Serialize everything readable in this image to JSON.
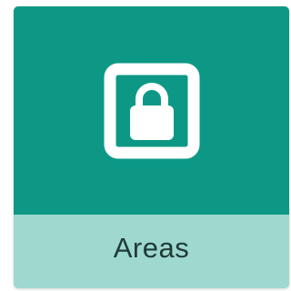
{
  "tile": {
    "label": "Areas",
    "icon": "lock-in-square-icon",
    "colors": {
      "top": "#0d9886",
      "bottom": "#9ed8cf",
      "icon": "#ffffff",
      "label": "#1f3a36"
    }
  }
}
